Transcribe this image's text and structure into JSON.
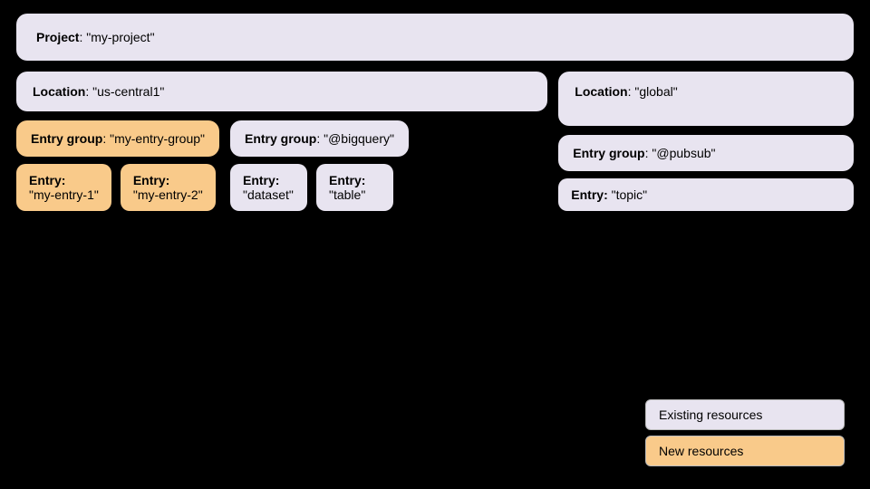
{
  "project": {
    "label": "Project",
    "value": "\"my-project\""
  },
  "locations": [
    {
      "id": "us-central1",
      "label": "Location",
      "value": "\"us-central1\"",
      "entry_groups": [
        {
          "id": "my-entry-group",
          "label": "Entry group",
          "value": "\"my-entry-group\"",
          "type": "orange",
          "entries": [
            {
              "label": "Entry",
              "value": "\"my-entry-1\"",
              "type": "orange"
            },
            {
              "label": "Entry",
              "value": "\"my-entry-2\"",
              "type": "orange"
            }
          ]
        },
        {
          "id": "bigquery",
          "label": "Entry group",
          "value": "\"@bigquery\"",
          "type": "purple",
          "entries": [
            {
              "label": "Entry",
              "value": "\"dataset\"",
              "type": "purple"
            },
            {
              "label": "Entry",
              "value": "\"table\"",
              "type": "purple"
            }
          ]
        }
      ]
    },
    {
      "id": "global",
      "label": "Location",
      "value": "\"global\"",
      "entry_groups": [
        {
          "id": "pubsub",
          "label": "Entry group",
          "value": "\"@pubsub\"",
          "type": "purple",
          "entries": [
            {
              "label": "Entry",
              "value": "\"topic\"",
              "type": "purple"
            }
          ]
        }
      ]
    }
  ],
  "legend": {
    "existing_label": "Existing resources",
    "new_label": "New resources"
  }
}
